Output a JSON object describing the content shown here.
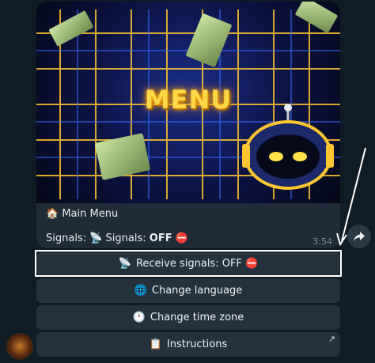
{
  "banner": {
    "title": "MENU"
  },
  "message": {
    "title_emoji": "🏠",
    "title": "Main Menu",
    "status_prefix": "Signals: ",
    "status_emoji": "📡",
    "status_label": "Signals: ",
    "status_value": "OFF",
    "status_badge": "⛔",
    "time": "3:54"
  },
  "keyboard": {
    "buttons": [
      {
        "emoji": "📡",
        "label": "Receive signals: OFF ⛔"
      },
      {
        "emoji": "🌐",
        "label": "Change language"
      },
      {
        "emoji": "🕐",
        "label": "Change time zone"
      },
      {
        "emoji": "📋",
        "label": "Instructions",
        "corner": "↗"
      }
    ]
  },
  "colors": {
    "bubble": "#1f2c37",
    "button": "#24323e",
    "background": "#0f1c26",
    "menu_text": "#ffd84a"
  }
}
